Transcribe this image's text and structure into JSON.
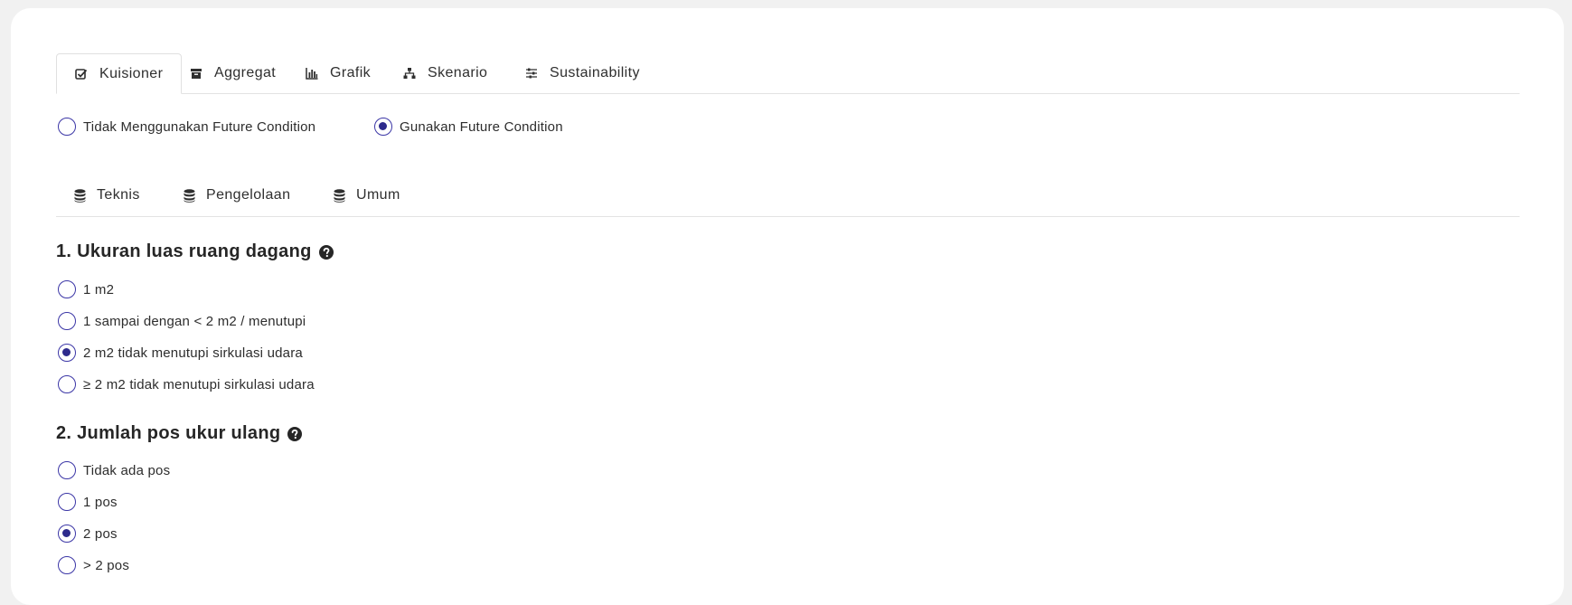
{
  "tabs": [
    {
      "label": "Kuisioner",
      "icon": "check-square-icon",
      "active": true
    },
    {
      "label": "Aggregat",
      "icon": "archive-icon",
      "active": false
    },
    {
      "label": "Grafik",
      "icon": "bar-chart-icon",
      "active": false
    },
    {
      "label": "Skenario",
      "icon": "sitemap-icon",
      "active": false
    },
    {
      "label": "Sustainability",
      "icon": "sliders-icon",
      "active": false
    }
  ],
  "future_condition": {
    "options": [
      {
        "label": "Tidak Menggunakan Future Condition",
        "checked": false
      },
      {
        "label": "Gunakan Future Condition",
        "checked": true
      }
    ]
  },
  "subtabs": [
    {
      "label": "Teknis",
      "icon": "database-icon"
    },
    {
      "label": "Pengelolaan",
      "icon": "database-icon"
    },
    {
      "label": "Umum",
      "icon": "database-icon"
    }
  ],
  "questions": [
    {
      "title": "1. Ukuran luas ruang dagang",
      "options": [
        {
          "label": "1 m2",
          "checked": false
        },
        {
          "label": "1 sampai dengan < 2 m2 / menutupi",
          "checked": false
        },
        {
          "label": "2 m2 tidak menutupi sirkulasi udara",
          "checked": true
        },
        {
          "label": "≥ 2 m2 tidak menutupi sirkulasi udara",
          "checked": false
        }
      ]
    },
    {
      "title": "2. Jumlah pos ukur ulang",
      "options": [
        {
          "label": "Tidak ada pos",
          "checked": false
        },
        {
          "label": "1 pos",
          "checked": false
        },
        {
          "label": "2 pos",
          "checked": true
        },
        {
          "label": "> 2 pos",
          "checked": false
        }
      ]
    }
  ],
  "colors": {
    "accent": "#2d2a8c",
    "radio_border": "#3b36a6",
    "page_bg": "#f1f1f1",
    "card_bg": "#ffffff"
  }
}
